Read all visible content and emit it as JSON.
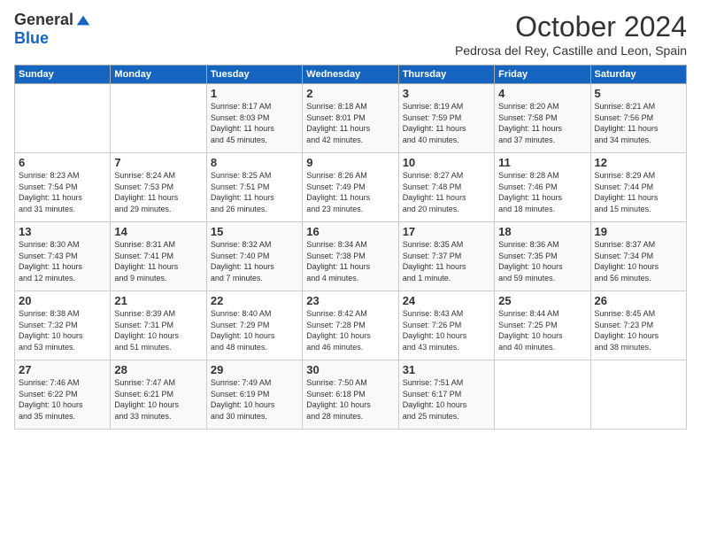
{
  "header": {
    "logo_general": "General",
    "logo_blue": "Blue",
    "month_title": "October 2024",
    "subtitle": "Pedrosa del Rey, Castille and Leon, Spain"
  },
  "weekdays": [
    "Sunday",
    "Monday",
    "Tuesday",
    "Wednesday",
    "Thursday",
    "Friday",
    "Saturday"
  ],
  "weeks": [
    [
      {
        "day": "",
        "info": ""
      },
      {
        "day": "",
        "info": ""
      },
      {
        "day": "1",
        "info": "Sunrise: 8:17 AM\nSunset: 8:03 PM\nDaylight: 11 hours\nand 45 minutes."
      },
      {
        "day": "2",
        "info": "Sunrise: 8:18 AM\nSunset: 8:01 PM\nDaylight: 11 hours\nand 42 minutes."
      },
      {
        "day": "3",
        "info": "Sunrise: 8:19 AM\nSunset: 7:59 PM\nDaylight: 11 hours\nand 40 minutes."
      },
      {
        "day": "4",
        "info": "Sunrise: 8:20 AM\nSunset: 7:58 PM\nDaylight: 11 hours\nand 37 minutes."
      },
      {
        "day": "5",
        "info": "Sunrise: 8:21 AM\nSunset: 7:56 PM\nDaylight: 11 hours\nand 34 minutes."
      }
    ],
    [
      {
        "day": "6",
        "info": "Sunrise: 8:23 AM\nSunset: 7:54 PM\nDaylight: 11 hours\nand 31 minutes."
      },
      {
        "day": "7",
        "info": "Sunrise: 8:24 AM\nSunset: 7:53 PM\nDaylight: 11 hours\nand 29 minutes."
      },
      {
        "day": "8",
        "info": "Sunrise: 8:25 AM\nSunset: 7:51 PM\nDaylight: 11 hours\nand 26 minutes."
      },
      {
        "day": "9",
        "info": "Sunrise: 8:26 AM\nSunset: 7:49 PM\nDaylight: 11 hours\nand 23 minutes."
      },
      {
        "day": "10",
        "info": "Sunrise: 8:27 AM\nSunset: 7:48 PM\nDaylight: 11 hours\nand 20 minutes."
      },
      {
        "day": "11",
        "info": "Sunrise: 8:28 AM\nSunset: 7:46 PM\nDaylight: 11 hours\nand 18 minutes."
      },
      {
        "day": "12",
        "info": "Sunrise: 8:29 AM\nSunset: 7:44 PM\nDaylight: 11 hours\nand 15 minutes."
      }
    ],
    [
      {
        "day": "13",
        "info": "Sunrise: 8:30 AM\nSunset: 7:43 PM\nDaylight: 11 hours\nand 12 minutes."
      },
      {
        "day": "14",
        "info": "Sunrise: 8:31 AM\nSunset: 7:41 PM\nDaylight: 11 hours\nand 9 minutes."
      },
      {
        "day": "15",
        "info": "Sunrise: 8:32 AM\nSunset: 7:40 PM\nDaylight: 11 hours\nand 7 minutes."
      },
      {
        "day": "16",
        "info": "Sunrise: 8:34 AM\nSunset: 7:38 PM\nDaylight: 11 hours\nand 4 minutes."
      },
      {
        "day": "17",
        "info": "Sunrise: 8:35 AM\nSunset: 7:37 PM\nDaylight: 11 hours\nand 1 minute."
      },
      {
        "day": "18",
        "info": "Sunrise: 8:36 AM\nSunset: 7:35 PM\nDaylight: 10 hours\nand 59 minutes."
      },
      {
        "day": "19",
        "info": "Sunrise: 8:37 AM\nSunset: 7:34 PM\nDaylight: 10 hours\nand 56 minutes."
      }
    ],
    [
      {
        "day": "20",
        "info": "Sunrise: 8:38 AM\nSunset: 7:32 PM\nDaylight: 10 hours\nand 53 minutes."
      },
      {
        "day": "21",
        "info": "Sunrise: 8:39 AM\nSunset: 7:31 PM\nDaylight: 10 hours\nand 51 minutes."
      },
      {
        "day": "22",
        "info": "Sunrise: 8:40 AM\nSunset: 7:29 PM\nDaylight: 10 hours\nand 48 minutes."
      },
      {
        "day": "23",
        "info": "Sunrise: 8:42 AM\nSunset: 7:28 PM\nDaylight: 10 hours\nand 46 minutes."
      },
      {
        "day": "24",
        "info": "Sunrise: 8:43 AM\nSunset: 7:26 PM\nDaylight: 10 hours\nand 43 minutes."
      },
      {
        "day": "25",
        "info": "Sunrise: 8:44 AM\nSunset: 7:25 PM\nDaylight: 10 hours\nand 40 minutes."
      },
      {
        "day": "26",
        "info": "Sunrise: 8:45 AM\nSunset: 7:23 PM\nDaylight: 10 hours\nand 38 minutes."
      }
    ],
    [
      {
        "day": "27",
        "info": "Sunrise: 7:46 AM\nSunset: 6:22 PM\nDaylight: 10 hours\nand 35 minutes."
      },
      {
        "day": "28",
        "info": "Sunrise: 7:47 AM\nSunset: 6:21 PM\nDaylight: 10 hours\nand 33 minutes."
      },
      {
        "day": "29",
        "info": "Sunrise: 7:49 AM\nSunset: 6:19 PM\nDaylight: 10 hours\nand 30 minutes."
      },
      {
        "day": "30",
        "info": "Sunrise: 7:50 AM\nSunset: 6:18 PM\nDaylight: 10 hours\nand 28 minutes."
      },
      {
        "day": "31",
        "info": "Sunrise: 7:51 AM\nSunset: 6:17 PM\nDaylight: 10 hours\nand 25 minutes."
      },
      {
        "day": "",
        "info": ""
      },
      {
        "day": "",
        "info": ""
      }
    ]
  ]
}
